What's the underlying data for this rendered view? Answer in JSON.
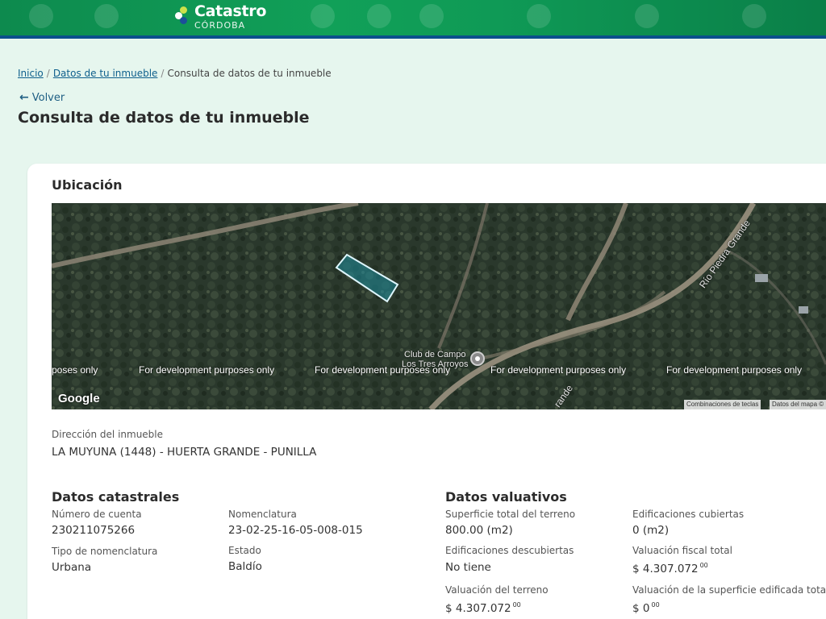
{
  "header": {
    "logo_title": "Catastro",
    "logo_subtitle": "CÓRDOBA"
  },
  "breadcrumb": {
    "items": [
      "Inicio",
      "Datos de tu inmueble",
      "Consulta de datos de tu inmueble"
    ],
    "separator": "/"
  },
  "back_label": "Volver",
  "page_title": "Consulta de datos de tu inmueble",
  "ubicacion": {
    "title": "Ubicación",
    "map": {
      "watermark": "For development purposes only",
      "watermark_partial": "poses only",
      "place_label_line1": "Club de Campo",
      "place_label_line2": "Los Tres Arroyos",
      "road_label_1": "Río Piedra Grande",
      "road_label_2": "rande",
      "google_logo": "Google",
      "attribution_1": "Combinaciones de teclas",
      "attribution_2": "Datos del mapa ©"
    },
    "direccion_label": "Dirección del inmueble",
    "direccion_value": "LA MUYUNA (1448) - HUERTA GRANDE - PUNILLA"
  },
  "datos_catastrales": {
    "title": "Datos catastrales",
    "numero_cuenta_label": "Número de cuenta",
    "numero_cuenta_value": "230211075266",
    "nomenclatura_label": "Nomenclatura",
    "nomenclatura_value": "23-02-25-16-05-008-015",
    "tipo_nomenclatura_label": "Tipo de nomenclatura",
    "tipo_nomenclatura_value": "Urbana",
    "estado_label": "Estado",
    "estado_value": "Baldío"
  },
  "datos_valuativos": {
    "title": "Datos valuativos",
    "superficie_label": "Superficie total del terreno",
    "superficie_value": "800.00 (m2)",
    "edif_cubiertas_label": "Edificaciones cubiertas",
    "edif_cubiertas_value": "0 (m2)",
    "edif_descubiertas_label": "Edificaciones descubiertas",
    "edif_descubiertas_value": "No tiene",
    "valuacion_fiscal_label": "Valuación fiscal total",
    "valuacion_fiscal_value": "$ 4.307.072",
    "valuacion_fiscal_cents": "00",
    "valuacion_terreno_label": "Valuación del terreno",
    "valuacion_terreno_value": "$ 4.307.072",
    "valuacion_terreno_cents": "00",
    "valuacion_edificada_label": "Valuación de la superficie edificada total",
    "valuacion_edificada_value": "$ 0",
    "valuacion_edificada_cents": "00"
  }
}
